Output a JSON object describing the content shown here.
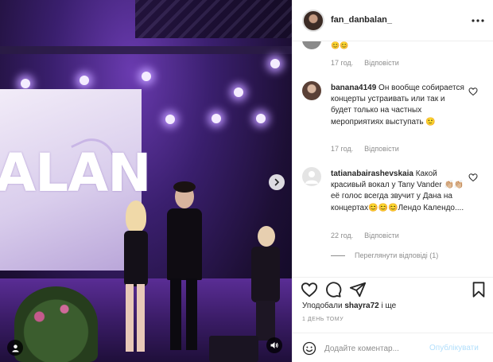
{
  "media": {
    "screen_text": "ALAN"
  },
  "header": {
    "username": "fan_danbalan_"
  },
  "comments": [
    {
      "emoji": "😊😊",
      "time": "17 год.",
      "reply": "Відповісти"
    },
    {
      "username": "banana4149",
      "text": "Он вообще собирается концерты устраивать или так и будет только на частных мероприятиях выступать 🙂",
      "time": "17 год.",
      "reply": "Відповісти"
    },
    {
      "username": "tatianabairashevskaia",
      "text": "Какой красивый вокал у Tany Vander 👏🏼👏🏼 её голос всегда звучит у Дана на концертах😊😊😊Лендо Календо....",
      "time": "22 год.",
      "reply": "Відповісти",
      "view_replies": "Переглянути відповіді (1)"
    }
  ],
  "actions": {
    "likes_prefix": "Уподобали ",
    "likes_user": "shayra72",
    "likes_suffix": " і ще",
    "post_time": "1 день тому"
  },
  "add_comment": {
    "placeholder": "Додайте коментар...",
    "publish_label": "Опублікувати"
  },
  "icons": {
    "more": "more-horizontal-icon",
    "heart": "heart-icon",
    "comment": "comment-icon",
    "share": "paper-plane-icon",
    "save": "bookmark-icon",
    "emoji": "smiley-icon",
    "next": "chevron-right-icon",
    "user_tag": "user-tag-icon",
    "mute": "speaker-icon"
  },
  "colors": {
    "text": "#262626",
    "muted": "#8e8e8e",
    "publish_disabled": "#b2dffc"
  }
}
